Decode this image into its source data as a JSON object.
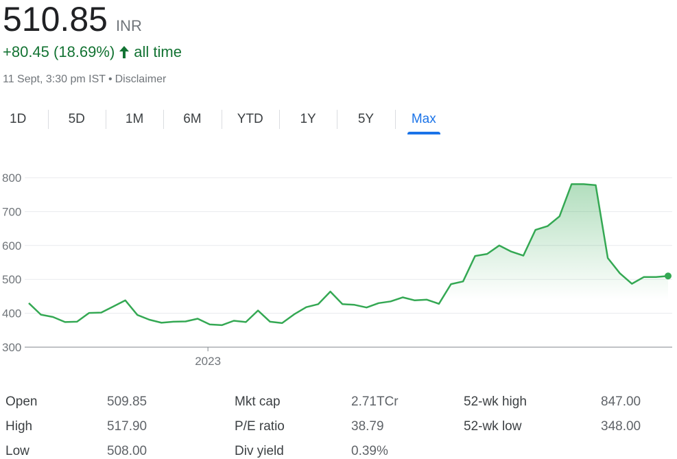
{
  "quote": {
    "price": "510.85",
    "currency": "INR",
    "change": "+80.45 (18.69%)",
    "change_period": "all time",
    "timestamp": "11 Sept, 3:30 pm IST",
    "separator": "•",
    "disclaimer": "Disclaimer",
    "up_color": "#137333"
  },
  "tabs": [
    {
      "label": "1D",
      "active": false
    },
    {
      "label": "5D",
      "active": false
    },
    {
      "label": "1M",
      "active": false
    },
    {
      "label": "6M",
      "active": false
    },
    {
      "label": "YTD",
      "active": false
    },
    {
      "label": "1Y",
      "active": false
    },
    {
      "label": "5Y",
      "active": false
    },
    {
      "label": "Max",
      "active": true
    }
  ],
  "chart_data": {
    "type": "area",
    "title": "",
    "xlabel": "",
    "ylabel": "",
    "ylim": [
      300,
      800
    ],
    "yticks": [
      300,
      400,
      500,
      600,
      700,
      800
    ],
    "x_tick_labels": [
      {
        "label": "2023",
        "index": 14.85
      }
    ],
    "grid": true,
    "line_color": "#34a853",
    "series": [
      {
        "values": [
          430,
          396,
          389,
          374,
          375,
          401,
          402,
          420,
          438,
          395,
          381,
          372,
          375,
          376,
          384,
          367,
          365,
          378,
          374,
          408,
          375,
          371,
          397,
          418,
          427,
          464,
          427,
          425,
          417,
          430,
          435,
          447,
          438,
          440,
          428,
          486,
          494,
          569,
          575,
          600,
          582,
          570,
          646,
          657,
          686,
          781,
          781,
          778,
          563,
          518,
          487,
          507,
          507,
          510
        ]
      }
    ]
  },
  "stats": {
    "open_label": "Open",
    "open": "509.85",
    "high_label": "High",
    "high": "517.90",
    "low_label": "Low",
    "low": "508.00",
    "mktcap_label": "Mkt cap",
    "mktcap": "2.71TCr",
    "pe_label": "P/E ratio",
    "pe": "38.79",
    "div_label": "Div yield",
    "div": "0.39%",
    "wkhigh_label": "52-wk high",
    "wkhigh": "847.00",
    "wklow_label": "52-wk low",
    "wklow": "348.00"
  }
}
